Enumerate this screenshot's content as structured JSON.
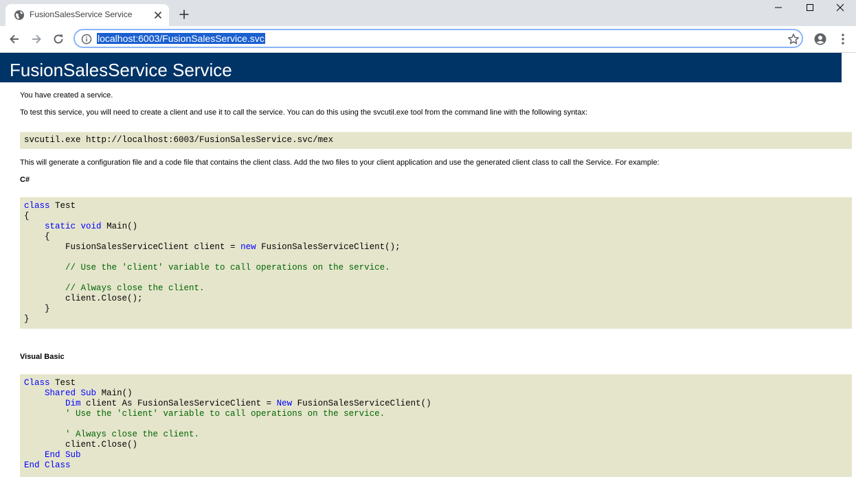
{
  "browser": {
    "tab": {
      "title": "FusionSalesService Service",
      "favicon": "globe-icon",
      "close_icon": "close-icon"
    },
    "new_tab_icon": "plus-icon",
    "window_controls": [
      "minimize-icon",
      "maximize-icon",
      "close-icon"
    ],
    "nav": {
      "back": "arrow-left-icon",
      "forward": "arrow-right-icon",
      "reload": "reload-icon"
    },
    "address_bar": {
      "url": "localhost:6003/FusionSalesService.svc",
      "info_icon": "info-icon",
      "bookmark_icon": "star-icon"
    },
    "account_icon": "account-icon",
    "menu_icon": "kebab-menu-icon"
  },
  "page": {
    "heading": "FusionSalesService Service",
    "intro": "You have created a service.",
    "test_instructions": "To test this service, you will need to create a client and use it to call the service. You can do this using the svcutil.exe tool from the command line with the following syntax:",
    "svcutil_command": "svcutil.exe http://localhost:6003/FusionSalesService.svc/mex",
    "generate_note": "This will generate a configuration file and a code file that contains the client class. Add the two files to your client application and use the generated client class to call the Service. For example:",
    "csharp_label": "C#",
    "csharp": {
      "l1_kw": "class",
      "l1_rest": " Test",
      "l2": "{",
      "l3_kw1": "static",
      "l3_kw2": "void",
      "l3_rest": " Main()",
      "l4": "{",
      "l5_a": "FusionSalesServiceClient client = ",
      "l5_kw": "new",
      "l5_b": " FusionSalesServiceClient();",
      "l6_comment": "// Use the 'client' variable to call operations on the service.",
      "l7_comment": "// Always close the client.",
      "l8": "client.Close();",
      "l9": "}",
      "l10": "}"
    },
    "vb_label": "Visual Basic",
    "vb": {
      "l1_kw": "Class",
      "l1_rest": " Test",
      "l2_kw1": "Shared",
      "l2_kw2": "Sub",
      "l2_rest": " Main()",
      "l3_kw1": "Dim",
      "l3_a": " client As FusionSalesServiceClient = ",
      "l3_kw2": "New",
      "l3_b": " FusionSalesServiceClient()",
      "l4_comment": "' Use the 'client' variable to call operations on the service.",
      "l5_comment": "' Always close the client.",
      "l6": "client.Close()",
      "l7_kw": "End Sub",
      "l8_kw": "End Class"
    }
  }
}
